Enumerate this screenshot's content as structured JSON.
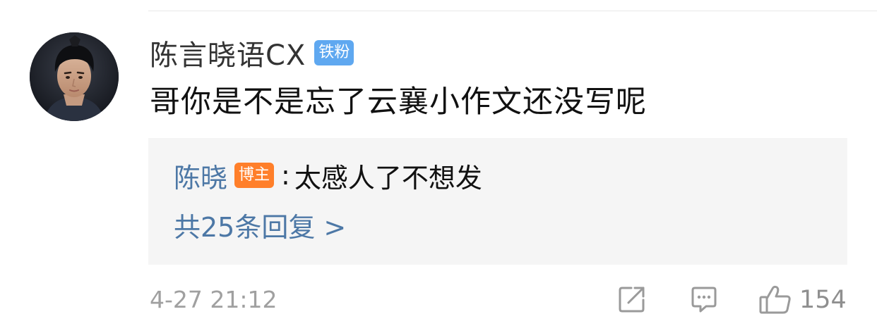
{
  "comment": {
    "username": "陈言晓语CX",
    "user_badge": "铁粉",
    "text": "哥你是不是忘了云襄小作文还没写呢",
    "timestamp": "4-27 21:12",
    "like_count": "154"
  },
  "reply": {
    "author": "陈晓",
    "author_badge": "博主",
    "separator": ":",
    "text": "太感人了不想发",
    "more_label": "共25条回复 >"
  },
  "icons": {
    "share": "share-icon",
    "comment": "comment-icon",
    "like": "thumbs-up-icon"
  },
  "colors": {
    "link_blue": "#4d78a6",
    "fan_badge": "#5fa8f0",
    "host_badge": "#ff7f2a",
    "reply_background": "#f5f5f5",
    "meta_gray": "#a0a0a0"
  }
}
